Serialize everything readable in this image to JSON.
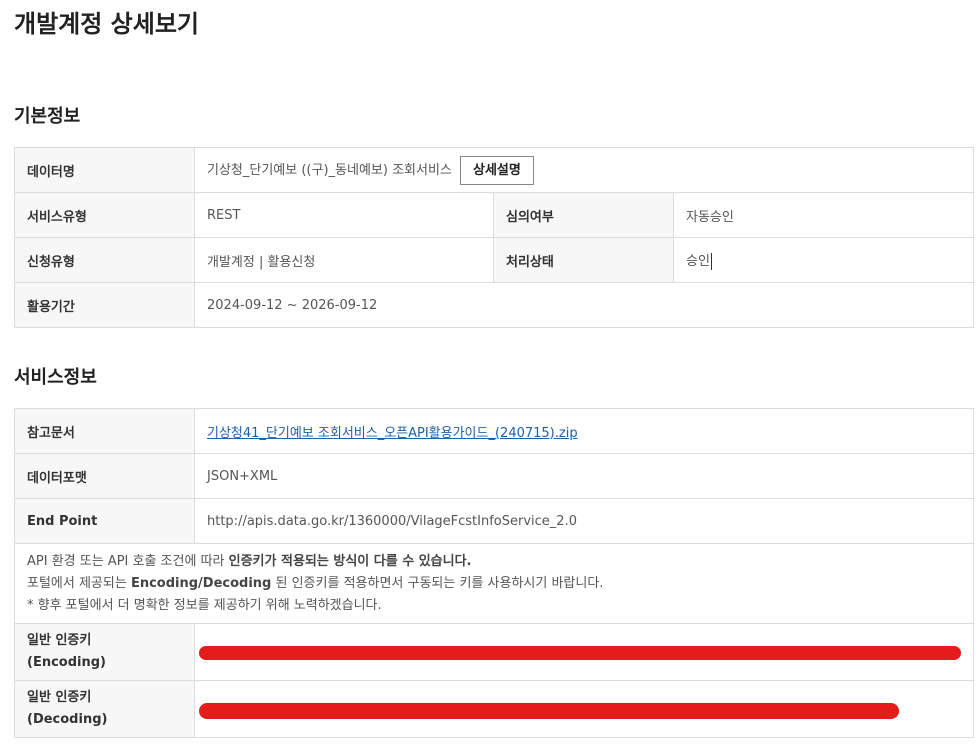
{
  "page": {
    "title": "개발계정 상세보기"
  },
  "basic_info": {
    "section_title": "기본정보",
    "data_name_label": "데이터명",
    "data_name_value": "기상청_단기예보 ((구)_동네예보) 조회서비스",
    "detail_button_label": "상세설명",
    "service_type_label": "서비스유형",
    "service_type_value": "REST",
    "review_label": "심의여부",
    "review_value": "자동승인",
    "request_type_label": "신청유형",
    "request_type_value": "개발계정 | 활용신청",
    "status_label": "처리상태",
    "status_value": "승인",
    "period_label": "활용기간",
    "period_value": "2024-09-12 ~ 2026-09-12"
  },
  "service_info": {
    "section_title": "서비스정보",
    "reference_label": "참고문서",
    "reference_link": "기상청41_단기예보 조회서비스_오픈API활용가이드_(240715).zip",
    "format_label": "데이터포맷",
    "format_value": "JSON+XML",
    "endpoint_label": "End Point",
    "endpoint_value": "http://apis.data.go.kr/1360000/VilageFcstInfoService_2.0",
    "notice": {
      "line1_prefix": "API 환경 또는 API 호출 조건에 따라 ",
      "line1_bold": "인증키가 적용되는 방식이 다를 수 있습니다.",
      "line2_prefix": "포털에서 제공되는 ",
      "line2_bold": "Encoding/Decoding",
      "line2_suffix": " 된 인증키를 적용하면서 구동되는 키를 사용하시기 바랍니다.",
      "line3": "* 향후 포털에서 더 명확한 정보를 제공하기 위해 노력하겠습니다."
    },
    "encoding_key_label": "일반 인증키",
    "encoding_key_sub": "(Encoding)",
    "decoding_key_label": "일반 인증키",
    "decoding_key_sub": "(Decoding)",
    "redaction_color": "#e51c1c"
  }
}
